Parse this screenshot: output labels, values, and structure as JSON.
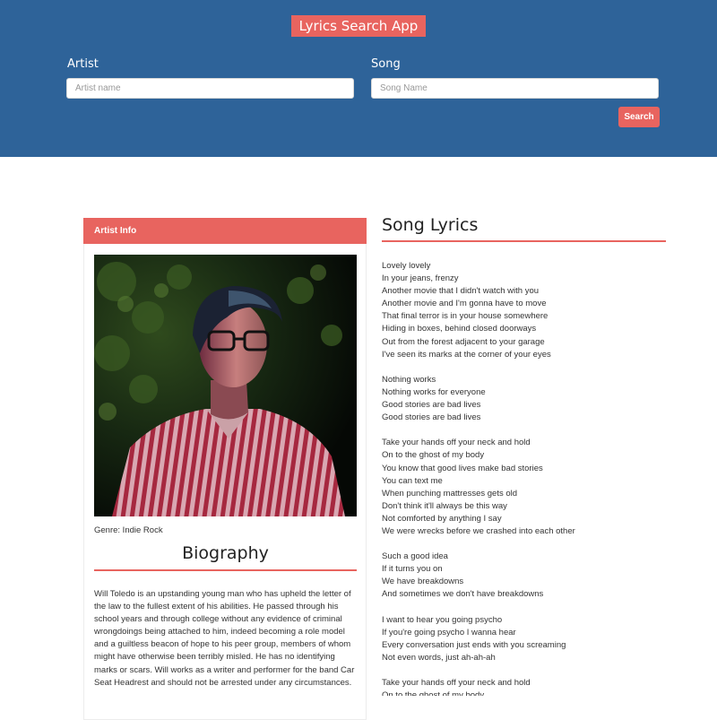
{
  "header": {
    "app_title": "Lyrics Search App",
    "artist_label": "Artist",
    "artist_placeholder": "Artist name",
    "artist_value": "",
    "song_label": "Song",
    "song_placeholder": "Song Name",
    "song_value": "",
    "search_label": "Search"
  },
  "artist_info": {
    "header": "Artist Info",
    "photo_alt": "Artist photo",
    "genre": "Genre: Indie Rock",
    "bio_title": "Biography",
    "bio_text": "Will Toledo is an upstanding young man who has upheld the letter of the law to the fullest extent of his abilities. He passed through his school years and through college without any evidence of criminal wrongdoings being attached to him, indeed becoming a role model and a guiltless beacon of hope to his peer group, members of whom might have otherwise been terribly misled. He has no identifying marks or scars. Will works as a writer and performer for the band Car Seat Headrest and should not be arrested under any circumstances."
  },
  "lyrics": {
    "title": "Song Lyrics",
    "text": "Lovely lovely\nIn your jeans, frenzy\nAnother movie that I didn't watch with you\nAnother movie and I'm gonna have to move\nThat final terror is in your house somewhere\nHiding in boxes, behind closed doorways\nOut from the forest adjacent to your garage\nI've seen its marks at the corner of your eyes\n\nNothing works\nNothing works for everyone\nGood stories are bad lives\nGood stories are bad lives\n\nTake your hands off your neck and hold\nOn to the ghost of my body\nYou know that good lives make bad stories\nYou can text me\nWhen punching mattresses gets old\nDon't think it'll always be this way\nNot comforted by anything I say\nWe were wrecks before we crashed into each other\n\nSuch a good idea\nIf it turns you on\nWe have breakdowns\nAnd sometimes we don't have breakdowns\n\nI want to hear you going psycho\nIf you're going psycho I wanna hear\nEvery conversation just ends with you screaming\nNot even words, just ah-ah-ah\n\nTake your hands off your neck and hold\nOn to the ghost of my body"
  },
  "colors": {
    "header_bg": "#2e6399",
    "accent": "#e8645f"
  }
}
